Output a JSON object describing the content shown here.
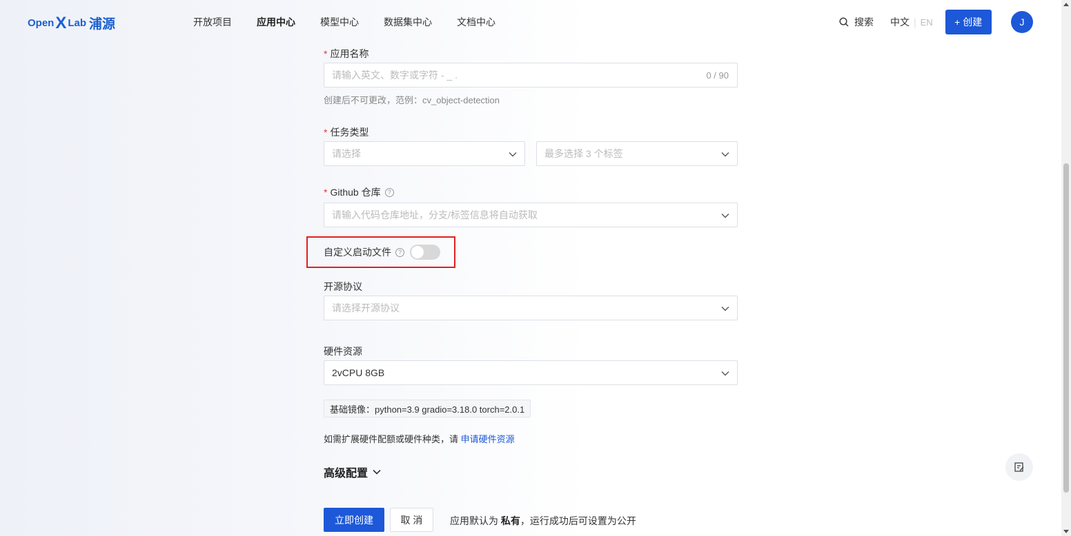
{
  "header": {
    "logo_prefix": "Open",
    "logo_x": "X",
    "logo_suffix": "Lab",
    "logo_cn": "浦源",
    "nav": [
      "开放项目",
      "应用中心",
      "模型中心",
      "数据集中心",
      "文档中心"
    ],
    "active_nav": "应用中心",
    "search_label": "搜索",
    "lang_zh": "中文",
    "lang_en": "EN",
    "create_label": "+ 创建",
    "avatar_letter": "J",
    "brand_color": "#1d58d8"
  },
  "form": {
    "app_name": {
      "label": "应用名称",
      "placeholder": "请输入英文、数字或字符 - _ .",
      "counter": "0 / 90",
      "hint": "创建后不可更改，范例：cv_object-detection"
    },
    "task_type": {
      "label": "任务类型",
      "select1_placeholder": "请选择",
      "select2_placeholder": "最多选择 3 个标签"
    },
    "github": {
      "label": "Github 仓库",
      "placeholder": "请输入代码仓库地址，分支/标签信息将自动获取"
    },
    "custom_start": {
      "label": "自定义启动文件",
      "enabled": false
    },
    "license": {
      "label": "开源协议",
      "placeholder": "请选择开源协议"
    },
    "hardware": {
      "label": "硬件资源",
      "value": "2vCPU 8GB",
      "base_image": "基础镜像：python=3.9 gradio=3.18.0 torch=2.0.1",
      "expand_note": "如需扩展硬件配额或硬件种类，请 ",
      "expand_link": "申请硬件资源"
    },
    "advanced_label": "高级配置",
    "submit_label": "立即创建",
    "cancel_label": "取 消",
    "visibility_prefix": "应用默认为 ",
    "visibility_bold": "私有",
    "visibility_suffix": "，运行成功后可设置为公开"
  }
}
